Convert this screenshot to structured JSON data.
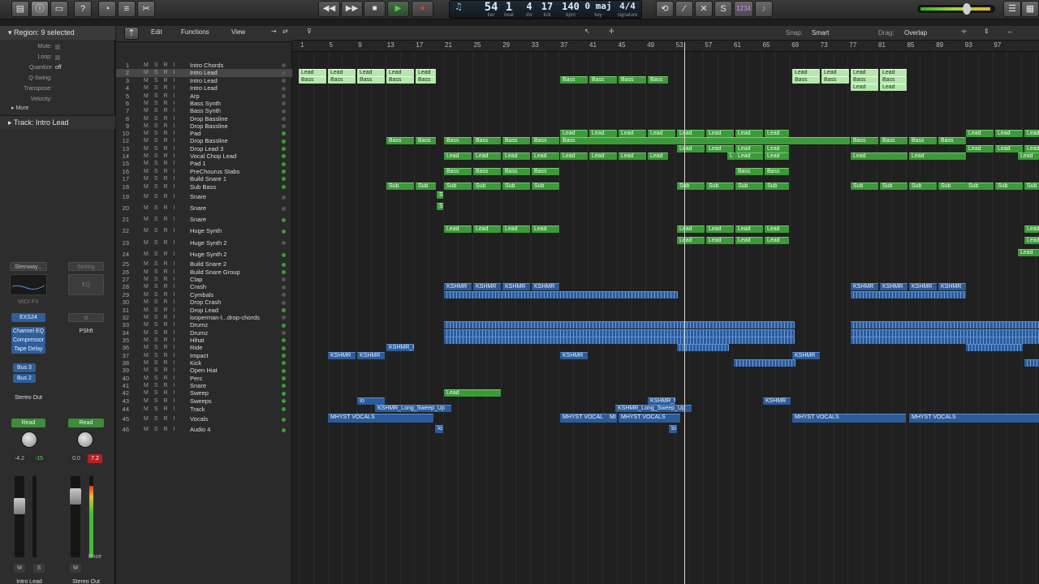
{
  "transport": {
    "bar": "54",
    "beat": "1",
    "div": "4",
    "tick": "17",
    "bpm": "140",
    "key": "0 maj",
    "signature": "4/4",
    "labels": {
      "bar": "bar",
      "beat": "beat",
      "div": "div",
      "tick": "tick",
      "bpm": "bpm",
      "key": "key",
      "signature": "signature"
    },
    "midi_display": "1234"
  },
  "inspector": {
    "region_header": "Region: 9 selected",
    "rows": [
      {
        "label": "Mute:",
        "value": ""
      },
      {
        "label": "Loop:",
        "value": ""
      },
      {
        "label": "Quantize",
        "value": "off"
      },
      {
        "label": "Q-Swing:",
        "value": ""
      },
      {
        "label": "Transpose:",
        "value": ""
      },
      {
        "label": "Velocity:",
        "value": ""
      }
    ],
    "more": "More",
    "track_header": "Track:  Intro Lead",
    "strip1": {
      "setting": "Steinway...",
      "midifx": "MIDI FX",
      "instrument": "EXS24",
      "inserts": [
        "Channel EQ",
        "Compressor",
        "Tape Delay"
      ],
      "sends": [
        "Bus 3",
        "Bus 2"
      ],
      "output": "Stereo Out",
      "auto": "Read",
      "vol": "-4.2",
      "pan": "-15",
      "name": "Intro Lead"
    },
    "strip2": {
      "setting": "Setting",
      "eq": "EQ",
      "insert": "PShft",
      "auto": "Read",
      "vol": "0.0",
      "peak": "7.2",
      "bounce": "Bnce",
      "name": "Stereo Out"
    }
  },
  "toolbar": {
    "edit": "Edit",
    "functions": "Functions",
    "view": "View",
    "snap_label": "Snap:",
    "snap": "Smart",
    "drag_label": "Drag:",
    "drag": "Overlap"
  },
  "track_header_buttons": {
    "h": "H",
    "s": "S"
  },
  "ruler_marks": [
    "1",
    "5",
    "9",
    "13",
    "17",
    "21",
    "25",
    "29",
    "33",
    "37",
    "41",
    "45",
    "49",
    "53",
    "57",
    "61",
    "65",
    "69",
    "73",
    "77",
    "81",
    "85",
    "89",
    "93",
    "97"
  ],
  "tracks": [
    {
      "n": "1",
      "name": "Intro Chords"
    },
    {
      "n": "2",
      "name": "Intro Lead"
    },
    {
      "n": "3",
      "name": "Intro Lead"
    },
    {
      "n": "4",
      "name": "Intro Lead"
    },
    {
      "n": "5",
      "name": "Arp"
    },
    {
      "n": "6",
      "name": "Bass Synth"
    },
    {
      "n": "7",
      "name": "Bass Synth"
    },
    {
      "n": "8",
      "name": "Drop Bassline"
    },
    {
      "n": "9",
      "name": "Drop Bassline"
    },
    {
      "n": "10",
      "name": "Pad"
    },
    {
      "n": "12",
      "name": "Drop Bassline"
    },
    {
      "n": "13",
      "name": "Drop Lead 3"
    },
    {
      "n": "14",
      "name": "Vocal Chop Lead"
    },
    {
      "n": "15",
      "name": "Pad 1"
    },
    {
      "n": "16",
      "name": "PreChourus Stabs"
    },
    {
      "n": "17",
      "name": "Build Snare 1"
    },
    {
      "n": "18",
      "name": "Sub Bass"
    },
    {
      "n": "19",
      "name": "Snare"
    },
    {
      "n": "20",
      "name": "Snare"
    },
    {
      "n": "21",
      "name": "Snare"
    },
    {
      "n": "22",
      "name": "Huge Synth"
    },
    {
      "n": "23",
      "name": "Huge Synth 2"
    },
    {
      "n": "24",
      "name": "Huge Synth 2"
    },
    {
      "n": "25",
      "name": "Build Snare 2"
    },
    {
      "n": "26",
      "name": "Build Snare Group"
    },
    {
      "n": "27",
      "name": "Clap"
    },
    {
      "n": "28",
      "name": "Crash"
    },
    {
      "n": "29",
      "name": "Cymbals"
    },
    {
      "n": "30",
      "name": "Drop Crash"
    },
    {
      "n": "31",
      "name": "Drop Lead"
    },
    {
      "n": "32",
      "name": "looperman-l...drop-chords"
    },
    {
      "n": "33",
      "name": "Drumz"
    },
    {
      "n": "34",
      "name": "Drumz"
    },
    {
      "n": "35",
      "name": "Hihat"
    },
    {
      "n": "36",
      "name": "Ride"
    },
    {
      "n": "37",
      "name": "Impact"
    },
    {
      "n": "38",
      "name": "Kick"
    },
    {
      "n": "39",
      "name": "Open Hiat"
    },
    {
      "n": "40",
      "name": "Perc"
    },
    {
      "n": "41",
      "name": "Snare"
    },
    {
      "n": "42",
      "name": "Sweep"
    },
    {
      "n": "43",
      "name": "Sweeps"
    },
    {
      "n": "44",
      "name": "Track"
    },
    {
      "n": "45",
      "name": "Vocals"
    },
    {
      "n": "46",
      "name": "Audio 4"
    }
  ],
  "region_labels": {
    "lead": "Lead",
    "bass": "Bass",
    "sub": "Sub",
    "kshmr": "KSHMR",
    "kshmr_c": "KSHMR_C",
    "kshmr_m": "KSHMR_M",
    "sweep": "KSHMR_Long_Sweep_Up",
    "vocals": "MHYST VOCALS",
    "vocal_short": "MHYST VOCAL",
    "mi": "MI",
    "io": "Io",
    "s": "S",
    "l": "L"
  },
  "colors": {
    "midi_region": "#3c9a3a",
    "selected_region": "#b6e8ae",
    "audio_region": "#2c5b9a",
    "playhead": "#d8d8d8"
  }
}
